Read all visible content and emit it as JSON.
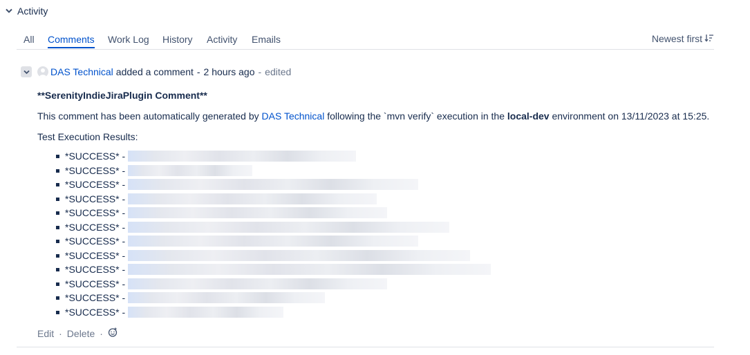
{
  "activity": {
    "title": "Activity"
  },
  "tabs": [
    {
      "label": "All"
    },
    {
      "label": "Comments"
    },
    {
      "label": "Work Log"
    },
    {
      "label": "History"
    },
    {
      "label": "Activity"
    },
    {
      "label": "Emails"
    }
  ],
  "sort": {
    "label": "Newest first"
  },
  "comment": {
    "author": "DAS Technical",
    "action": "added a comment",
    "sep": "-",
    "time": "2 hours ago",
    "edited": "edited",
    "title": "**SerenityIndieJiraPlugin Comment**",
    "intro_prefix": "This comment has been automatically generated by ",
    "intro_author": "DAS Technical",
    "intro_mid": " following the `mvn verify` execution in the ",
    "intro_env": "local-dev",
    "intro_suffix": " environment on 13/11/2023 at 15:25.",
    "results_heading": "Test Execution Results:",
    "results": [
      {
        "status": "*SUCCESS* -"
      },
      {
        "status": "*SUCCESS* -"
      },
      {
        "status": "*SUCCESS* -"
      },
      {
        "status": "*SUCCESS* -"
      },
      {
        "status": "*SUCCESS* -"
      },
      {
        "status": "*SUCCESS* -"
      },
      {
        "status": "*SUCCESS* -"
      },
      {
        "status": "*SUCCESS* -"
      },
      {
        "status": "*SUCCESS* -"
      },
      {
        "status": "*SUCCESS* -"
      },
      {
        "status": "*SUCCESS* -"
      },
      {
        "status": "*SUCCESS* -"
      }
    ]
  },
  "actions": {
    "edit": "Edit",
    "delete": "Delete",
    "separator": "·",
    "reaction_icon": "emoji-reaction-icon"
  },
  "colors": {
    "link": "#0052cc",
    "text": "#172b4d",
    "muted": "#6b778c",
    "rule": "#dfe1e6"
  }
}
